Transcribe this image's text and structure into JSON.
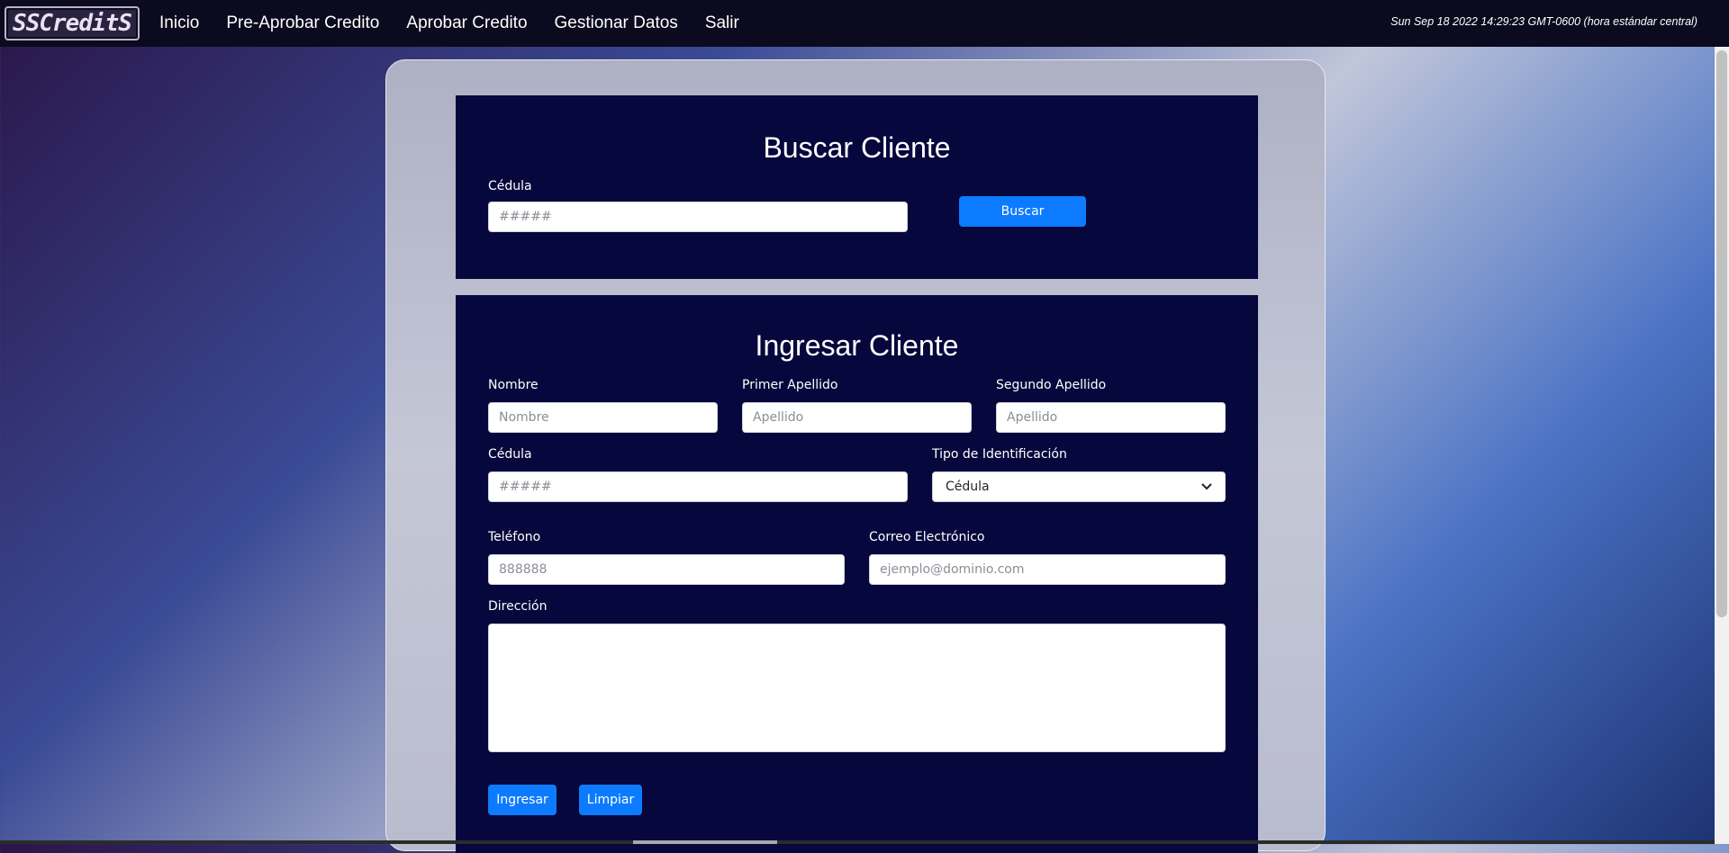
{
  "nav": {
    "logo_text": "SSCreditS",
    "links": [
      "Inicio",
      "Pre-Aprobar Credito",
      "Aprobar Credito",
      "Gestionar Datos",
      "Salir"
    ],
    "datetime": "Sun Sep 18 2022 14:29:23 GMT-0600 (hora estándar central)"
  },
  "search": {
    "title": "Buscar Cliente",
    "cedula_label": "Cédula",
    "cedula_placeholder": "#####",
    "button_label": "Buscar"
  },
  "client": {
    "title": "Ingresar Cliente",
    "nombre_label": "Nombre",
    "nombre_placeholder": "Nombre",
    "primer_apellido_label": "Primer Apellido",
    "primer_apellido_placeholder": "Apellido",
    "segundo_apellido_label": "Segundo Apellido",
    "segundo_apellido_placeholder": "Apellido",
    "cedula_label": "Cédula",
    "cedula_placeholder": "#####",
    "tipo_id_label": "Tipo de Identificación",
    "tipo_id_value": "Cédula",
    "telefono_label": "Teléfono",
    "telefono_placeholder": "888888",
    "correo_label": "Correo Electrónico",
    "correo_placeholder": "ejemplo@dominio.com",
    "direccion_label": "Dirección",
    "ingresar_label": "Ingresar",
    "limpiar_label": "Limpiar"
  },
  "colors": {
    "accent": "#0d7bff",
    "card_bg": "#06073c",
    "navbar_bg": "#0b0a1e"
  }
}
